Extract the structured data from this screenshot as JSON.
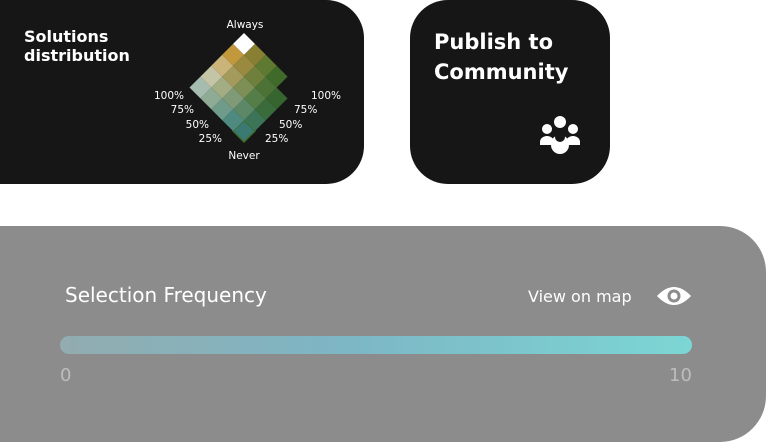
{
  "solutions_card": {
    "title": "Solutions\ndistribution",
    "top_label": "Always",
    "bottom_label": "Never",
    "left_scale": [
      "100%",
      "75%",
      "50%",
      "25%"
    ],
    "right_scale": [
      "100%",
      "75%",
      "50%",
      "25%"
    ],
    "matrix_colors": [
      [
        "#3a7a73",
        "#4f8a80",
        "#6f9b8a",
        "#8eab95",
        "#a7bcb1"
      ],
      [
        "#3c7458",
        "#5c8868",
        "#7f9a76",
        "#a3ad84",
        "#c4c5a6"
      ],
      [
        "#3a6b3a",
        "#557d48",
        "#7d8f55",
        "#a39a5c",
        "#cbb47a"
      ],
      [
        "#366530",
        "#4c7236",
        "#6f803c",
        "#998a40",
        "#c2983d"
      ],
      [
        "#161616",
        "#3f6a2a",
        "#5e7a30",
        "#897f32",
        "#b98c33"
      ]
    ],
    "top_cell_color": "#ffffff"
  },
  "publish_card": {
    "title": "Publish to\nCommunity",
    "icon": "community-icon"
  },
  "frequency_card": {
    "title": "Selection Frequency",
    "view_link": "View on map",
    "icon": "eye-icon",
    "scale_min": "0",
    "scale_max": "10",
    "bar_colors": [
      "#92acb0",
      "#7db6c5",
      "#7cd6d4"
    ]
  }
}
